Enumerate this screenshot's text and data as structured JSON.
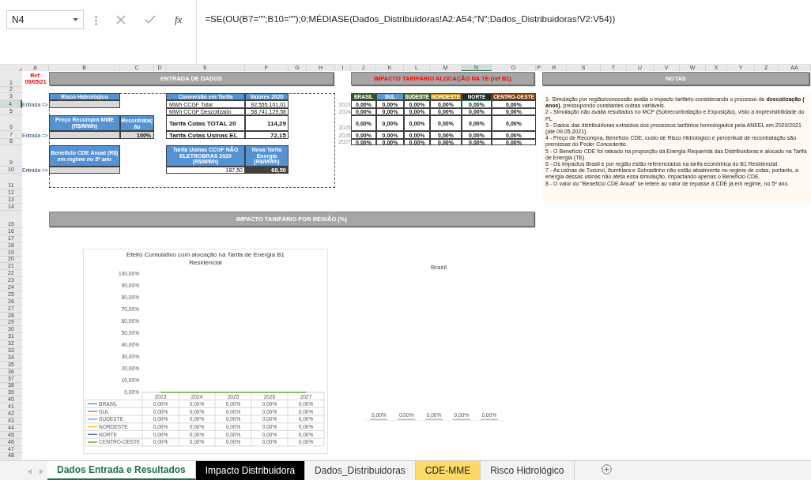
{
  "formula_bar": {
    "name_box": "N4",
    "function_label": "fx",
    "formula": "=SE(OU(B7=\"\";B10=\"\");0;MÉDIASE(Dados_Distribuidoras!A2:A54;\"N\";Dados_Distribuidoras!V2:V54))"
  },
  "columns": [
    {
      "label": "A",
      "selected": false
    },
    {
      "label": "B",
      "selected": false
    },
    {
      "label": "C",
      "selected": false
    },
    {
      "label": "D",
      "selected": false
    },
    {
      "label": "E",
      "selected": false
    },
    {
      "label": "F",
      "selected": false
    },
    {
      "label": "G",
      "selected": false
    },
    {
      "label": "H",
      "selected": false
    },
    {
      "label": "I",
      "selected": false
    },
    {
      "label": "J",
      "selected": false
    },
    {
      "label": "K",
      "selected": false
    },
    {
      "label": "L",
      "selected": false
    },
    {
      "label": "M",
      "selected": false
    },
    {
      "label": "N",
      "selected": true
    },
    {
      "label": "O",
      "selected": false
    },
    {
      "label": "P",
      "selected": false
    },
    {
      "label": "R",
      "selected": false
    },
    {
      "label": "S",
      "selected": false
    },
    {
      "label": "T",
      "selected": false
    },
    {
      "label": "U",
      "selected": false
    },
    {
      "label": "V",
      "selected": false
    },
    {
      "label": "W",
      "selected": false
    },
    {
      "label": "X",
      "selected": false
    },
    {
      "label": "Y",
      "selected": false
    },
    {
      "label": "Z",
      "selected": false
    },
    {
      "label": "AA",
      "selected": false
    }
  ],
  "rows": [
    {
      "label": "1",
      "selected": false
    },
    {
      "label": "2",
      "selected": false
    },
    {
      "label": "3",
      "selected": false
    },
    {
      "label": "4",
      "selected": true
    },
    {
      "label": "5",
      "selected": false
    },
    {
      "label": "6",
      "selected": false
    },
    {
      "label": "7",
      "selected": false
    },
    {
      "label": "8",
      "selected": false
    },
    {
      "label": "9",
      "selected": false
    },
    {
      "label": "10",
      "selected": false
    },
    {
      "label": "11",
      "selected": false
    },
    {
      "label": "12",
      "selected": false
    },
    {
      "label": "13",
      "selected": false
    },
    {
      "label": "14",
      "selected": false
    },
    {
      "label": "15",
      "selected": false
    },
    {
      "label": "16",
      "selected": false
    },
    {
      "label": "17",
      "selected": false
    },
    {
      "label": "18",
      "selected": false
    },
    {
      "label": "19",
      "selected": false
    },
    {
      "label": "20",
      "selected": false
    },
    {
      "label": "21",
      "selected": false
    },
    {
      "label": "22",
      "selected": false
    },
    {
      "label": "23",
      "selected": false
    },
    {
      "label": "24",
      "selected": false
    },
    {
      "label": "25",
      "selected": false
    },
    {
      "label": "26",
      "selected": false
    },
    {
      "label": "27",
      "selected": false
    },
    {
      "label": "28",
      "selected": false
    },
    {
      "label": "29",
      "selected": false
    },
    {
      "label": "30",
      "selected": false
    },
    {
      "label": "31",
      "selected": false
    },
    {
      "label": "32",
      "selected": false
    },
    {
      "label": "33",
      "selected": false
    },
    {
      "label": "34",
      "selected": false
    },
    {
      "label": "35",
      "selected": false
    },
    {
      "label": "36",
      "selected": false
    },
    {
      "label": "37",
      "selected": false
    },
    {
      "label": "38",
      "selected": false
    },
    {
      "label": "39",
      "selected": false
    },
    {
      "label": "40",
      "selected": false
    },
    {
      "label": "41",
      "selected": false
    },
    {
      "label": "42",
      "selected": false
    },
    {
      "label": "43",
      "selected": false
    },
    {
      "label": "44",
      "selected": false
    },
    {
      "label": "45",
      "selected": false
    },
    {
      "label": "46",
      "selected": false
    },
    {
      "label": "47",
      "selected": false
    },
    {
      "label": "48",
      "selected": false
    }
  ],
  "reference": {
    "label": "Ref:",
    "date": "09/05/21"
  },
  "input_section": {
    "title": "ENTRADA DE DADOS",
    "entry_labels": [
      "Entrada =>",
      "Entrada =>",
      "Entrada =>"
    ],
    "risco_header": "Risco Hidrológico",
    "recompra_header": "Preço Recompra MME (R$/MWh)",
    "recontratacao_header": "Recontratação",
    "recontratacao_value": "100%",
    "cde_header": "Benefício CDE Anual (R$) *em regime no 5º ano*",
    "conversion": {
      "headers": [
        "Conversão em Tarifa",
        "Valores 2020"
      ],
      "rows": [
        {
          "kind": "plain",
          "label": "MWh CCGF Total",
          "value": "92.555.101,01"
        },
        {
          "kind": "plain",
          "label": "MWh CCGF Descotizado",
          "value": "58.741.129,58"
        },
        {
          "kind": "total",
          "label": "Tarifa Cotas TOTAL 20",
          "value": "114,29"
        },
        {
          "kind": "total",
          "label": "Tarifa Cotas Usinas EL",
          "value": "72,15"
        }
      ]
    },
    "usinas": {
      "headers": [
        "Tarifa Usinas CCGF NÃO ELETROBRAS 2020 (R$/MWh)",
        "Nova Tarifa Energia (R$/MWh)"
      ],
      "values": [
        "187,50",
        "68,50"
      ]
    }
  },
  "impact_table": {
    "title": "IMPACTO TARIFÁRIO ALOCAÇÃO NA TE (ref B1)",
    "regions": [
      {
        "name": "BRASIL",
        "color": "#375623"
      },
      {
        "name": "SUL",
        "color": "#5b9bd5"
      },
      {
        "name": "SUDESTE",
        "color": "#548235"
      },
      {
        "name": "NORDESTE",
        "color": "#bf8f00"
      },
      {
        "name": "NORTE",
        "color": "#262626"
      },
      {
        "name": "CENTRO-OESTE",
        "color": "#843c0c"
      }
    ],
    "rows": [
      {
        "year": "2023",
        "values": [
          "0,00%",
          "0,00%",
          "0,00%",
          "0,00%",
          "0,00%",
          "0,00%"
        ]
      },
      {
        "year": "2024",
        "values": [
          "0,00%",
          "0,00%",
          "0,00%",
          "0,00%",
          "0,00%",
          "0,00%"
        ]
      },
      {
        "year": "2025",
        "values": [
          "0,00%",
          "0,00%",
          "0,00%",
          "0,00%",
          "0,00%",
          "0,00%"
        ]
      },
      {
        "year": "2026",
        "values": [
          "0,00%",
          "0,00%",
          "0,00%",
          "0,00%",
          "0,00%",
          "0,00%"
        ]
      },
      {
        "year": "2027",
        "values": [
          "0,00%",
          "0,00%",
          "0,00%",
          "0,00%",
          "0,00%",
          "0,00%"
        ]
      }
    ]
  },
  "notes": {
    "title": "NOTAS",
    "items": [
      "1- Simulação por região/concessão avalia o impacto tarifário considerando o processo de **descotização (** **anos)**, pressupondo constantes outras variáveis.",
      "2 - Simulação não avalia resultados no MCP (Sobrecontratação e Exposição), visto a imprevisibilidade do PL",
      "3 - Dados das distribuidoras extraídos dos processos tarifários homologados pela ANEEL em 2020/2021 (até 09.05.2021).",
      "4 - Preço de Recompra, Benefício CDE, custo de Risco Hidrológico e percentual de recontratação são premissas do Poder Concedente.",
      "5 - O Benefício CDE foi rateado na proporção da Energia Requerida das Distribuidoras e alocado na Tarifa de Energia (TE).",
      "6 - Os  Impactos Brasil e por região estão referenciados na tarifa econômica do  B1 Residencial.",
      "7 - As usinas de Tucuruí, Itumbiara e Sobradinho não estão atualmente no regime de cotas, portanto, a energia dessas usinas não afeta essa simulação, impactando apenas o Benefício CDE.",
      "8 - O valor do \"Benefício CDE Anual\" se refere ao valor de repasse à CDE já em regime, no 5º ano."
    ]
  },
  "region_impact": {
    "title": "IMPACTO TARIFÁRIO POR REGIÃO (%)",
    "cumulative_chart": {
      "chart_data": {
        "type": "line",
        "title": "Efeito Cumulativo com alocação na Tarifa de Energia B1 Residencial",
        "categories": [
          "2023",
          "2024",
          "2025",
          "2026",
          "2027"
        ],
        "legend": "bottom",
        "ylim": [
          0,
          1
        ],
        "yticks": [
          {
            "value": 0,
            "label": "0,00%"
          },
          {
            "value": 0.1,
            "label": "10,00%"
          },
          {
            "value": 0.2,
            "label": "20,00%"
          },
          {
            "value": 0.3,
            "label": "30,00%"
          },
          {
            "value": 0.4,
            "label": "40,00%"
          },
          {
            "value": 0.5,
            "label": "50,00%"
          },
          {
            "value": 0.6,
            "label": "60,00%"
          },
          {
            "value": 0.7,
            "label": "70,00%"
          },
          {
            "value": 0.8,
            "label": "80,00%"
          },
          {
            "value": 0.9,
            "label": "90,00%"
          },
          {
            "value": 1,
            "label": "100,00%"
          }
        ],
        "series": [
          {
            "name": "BRASIL",
            "color": "#5b9bd5",
            "values": [
              null,
              null,
              null,
              null,
              null
            ]
          },
          {
            "name": "SUL",
            "color": "#ed7d31",
            "values": [
              null,
              null,
              null,
              null,
              null
            ]
          },
          {
            "name": "SUDESTE",
            "color": "#a5a5a5",
            "values": [
              null,
              null,
              null,
              null,
              null
            ]
          },
          {
            "name": "NORDESTE",
            "color": "#ffc000",
            "values": [
              null,
              null,
              null,
              null,
              null
            ]
          },
          {
            "name": "NORTE",
            "color": "#4472c4",
            "values": [
              null,
              null,
              null,
              null,
              null
            ]
          },
          {
            "name": "CENTRO-OESTE",
            "color": "#70ad47",
            "values": [
              0,
              0,
              0,
              0,
              0
            ]
          }
        ]
      },
      "data_table": [
        [
          "0,00%",
          "0,00%",
          "0,00%",
          "0,00%",
          "0,00%"
        ],
        [
          "0,00%",
          "0,00%",
          "0,00%",
          "0,00%",
          "0,00%"
        ],
        [
          "0,00%",
          "0,00%",
          "0,00%",
          "0,00%",
          "0,00%"
        ],
        [
          "0,00%",
          "0,00%",
          "0,00%",
          "0,00%",
          "0,00%"
        ],
        [
          "0,00%",
          "0,00%",
          "0,00%",
          "0,00%",
          "0,00%"
        ],
        [
          "0,00%",
          "0,00%",
          "0,00%",
          "0,00%",
          "0,00%"
        ]
      ]
    },
    "brasil_chart": {
      "title": "Brasil",
      "bar_labels": [
        "0,00%",
        "0,00%",
        "0,00%",
        "0,00%",
        "0,00%"
      ]
    }
  },
  "sheet_tabs": [
    {
      "label": "Dados Entrada e Resultados",
      "selected": true
    },
    {
      "label": "Impacto Distribuidora",
      "selected": false,
      "color": "#000000"
    },
    {
      "label": "Dados_Distribuidoras",
      "selected": false
    },
    {
      "label": "CDE-MME",
      "selected": false,
      "color": "#ffd966"
    },
    {
      "label": "Risco Hidrológico",
      "selected": false
    }
  ]
}
